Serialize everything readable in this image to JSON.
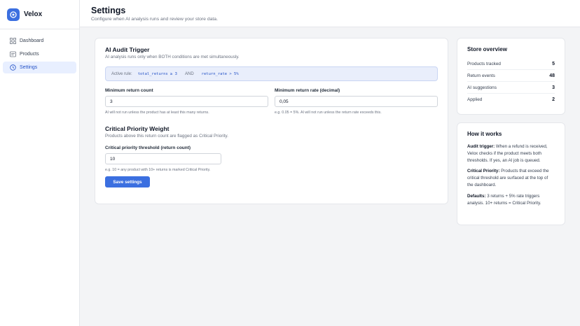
{
  "app": {
    "name": "Velox"
  },
  "sidebar": {
    "items": [
      {
        "label": "Dashboard",
        "icon": "grid-icon"
      },
      {
        "label": "Products",
        "icon": "box-icon"
      },
      {
        "label": "Settings",
        "icon": "clock-icon"
      }
    ]
  },
  "header": {
    "title": "Settings",
    "subtitle": "Configure when AI analysis runs and review your store data."
  },
  "audit": {
    "title": "AI Audit Trigger",
    "subtitle": "AI analysis runs only when BOTH conditions are met simultaneously.",
    "active_rule_label": "Active rule:",
    "rule_a": "total_returns ≥ 3",
    "and_label": "AND",
    "rule_b": "return_rate > 5%",
    "min_count": {
      "label": "Minimum return count",
      "value": "3",
      "hint": "AI will not run unless the product has at least this many returns."
    },
    "min_rate": {
      "label": "Minimum return rate (decimal)",
      "value": "0,05",
      "hint": "e.g. 0.05 = 5%. AI will not run unless the return rate exceeds this."
    }
  },
  "critical": {
    "title": "Critical Priority Weight",
    "subtitle": "Products above this return count are flagged as Critical Priority.",
    "threshold": {
      "label": "Critical priority threshold (return count)",
      "value": "10",
      "hint": "e.g. 10 = any product with 10+ returns is marked Critical Priority."
    },
    "save_label": "Save settings"
  },
  "overview": {
    "title": "Store overview",
    "rows": [
      {
        "label": "Products tracked",
        "value": "5"
      },
      {
        "label": "Return events",
        "value": "48"
      },
      {
        "label": "AI suggestions",
        "value": "3"
      },
      {
        "label": "Applied",
        "value": "2"
      }
    ]
  },
  "how_it_works": {
    "title": "How it works",
    "items": [
      {
        "term": "Audit trigger:",
        "text": "When a refund is received, Velox checks if the product meets both thresholds. If yes, an AI job is queued."
      },
      {
        "term": "Critical Priority:",
        "text": "Products that exceed the critical threshold are surfaced at the top of the dashboard."
      },
      {
        "term": "Defaults:",
        "text": "3 returns + 5% rate triggers analysis. 10+ returns = Critical Priority."
      }
    ]
  },
  "colors": {
    "accent": "#3b6fe0",
    "active_bg": "#e8efff"
  }
}
